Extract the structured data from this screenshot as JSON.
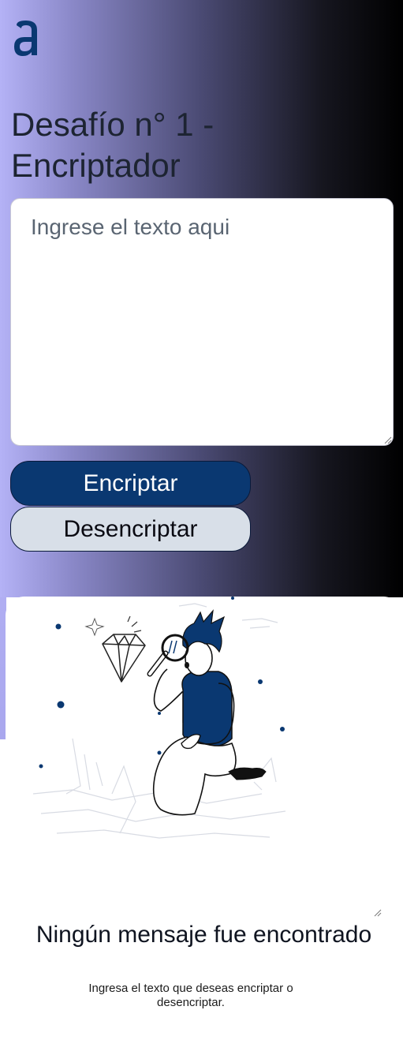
{
  "header": {
    "logo_icon": "alura-a-logo-icon",
    "title": "Desafío n° 1 - Encriptador"
  },
  "input": {
    "placeholder": "Ingrese el texto aqui",
    "value": ""
  },
  "buttons": {
    "encrypt_label": "Encriptar",
    "decrypt_label": "Desencriptar"
  },
  "output": {
    "illustration": "person-with-magnifying-glass-illustration",
    "title": "Ningún mensaje fue encontrado",
    "subtitle": "Ingresa el texto que deseas encriptar o desencriptar."
  },
  "colors": {
    "primary": "#0A3871",
    "secondary_button": "#D8DFE8",
    "gradient_start": "#B4B2F6",
    "gradient_end": "#000000"
  }
}
